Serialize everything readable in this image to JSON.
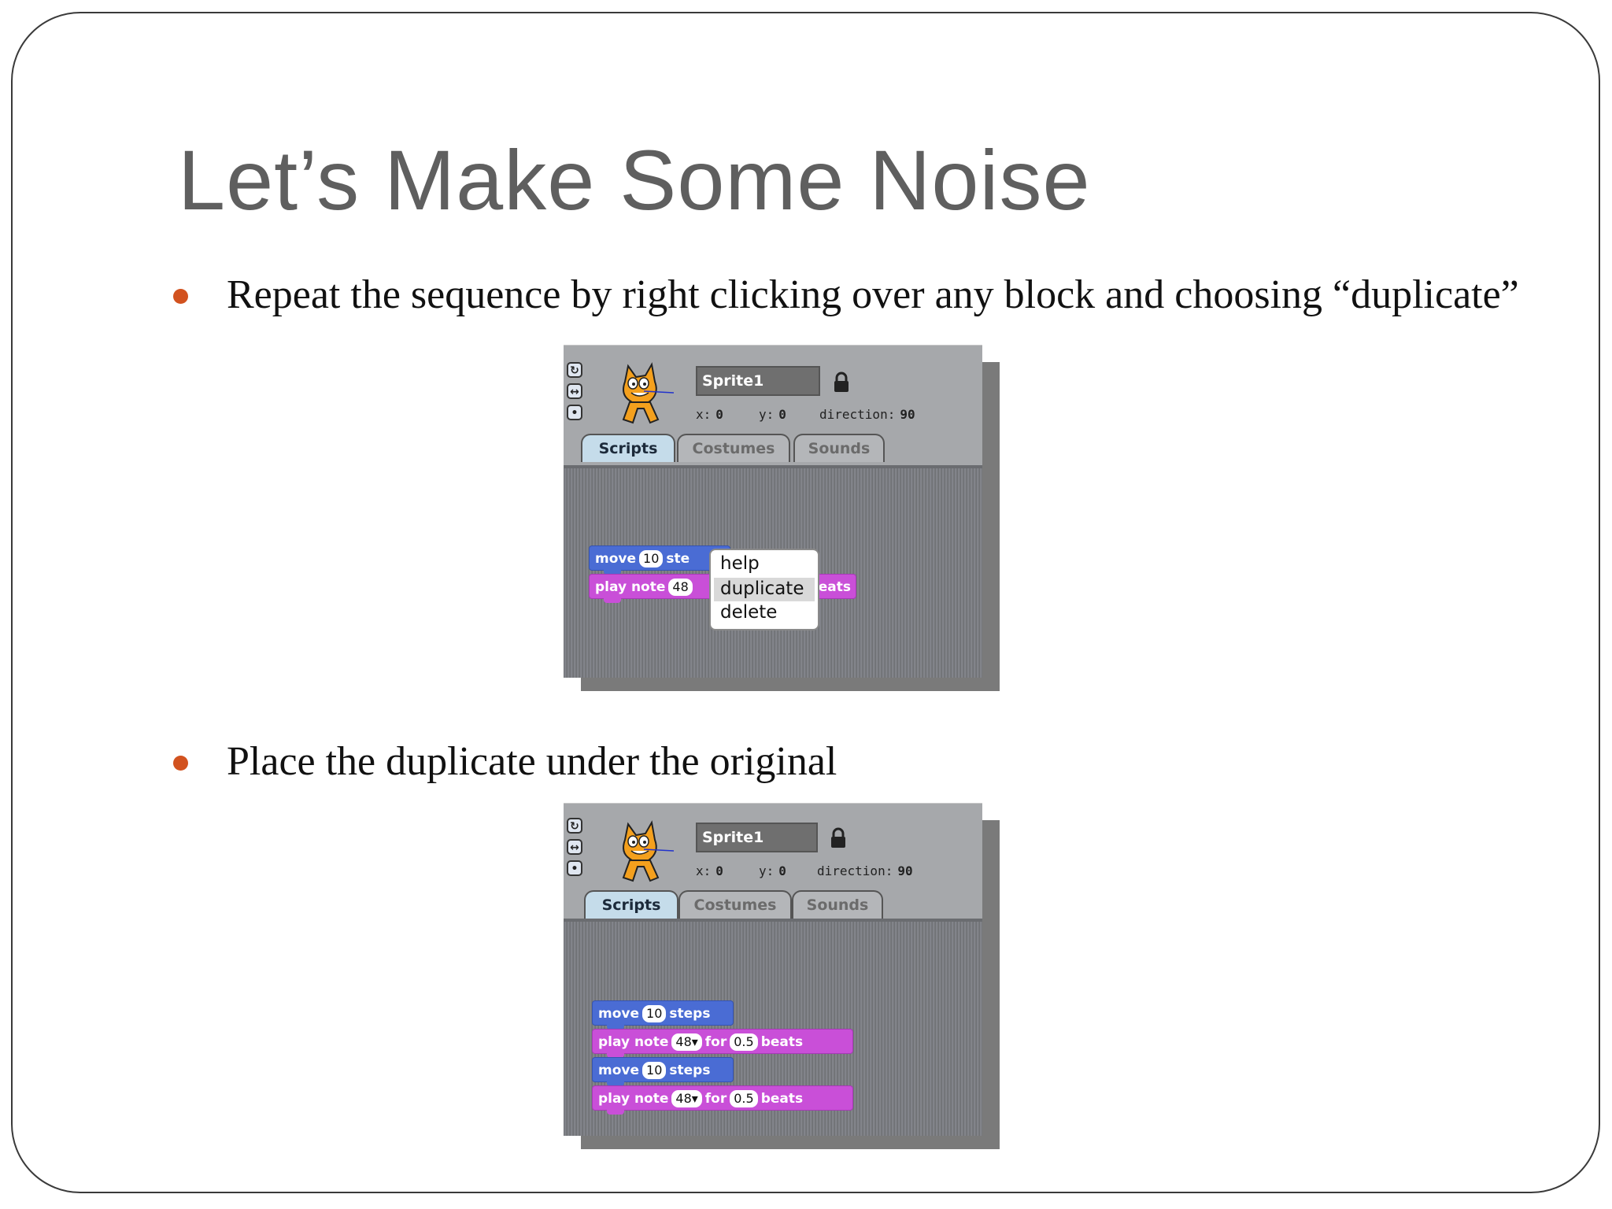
{
  "slide": {
    "title": "Let’s Make Some Noise",
    "bullets": [
      "Repeat the sequence by right clicking over any block  and choosing “duplicate”",
      "Place the duplicate under the original"
    ],
    "accent_color": "#d2521f"
  },
  "panel1": {
    "sprite_name": "Sprite1",
    "x_label": "x:",
    "x_value": "0",
    "y_label": "y:",
    "y_value": "0",
    "direction_label": "direction:",
    "direction_value": "90",
    "tabs": [
      "Scripts",
      "Costumes",
      "Sounds"
    ],
    "block_move": {
      "word": "move",
      "value": "10",
      "suffix": "ste"
    },
    "block_play": {
      "word": "play note",
      "value": "48",
      "suffix": "eats"
    },
    "context_menu": [
      "help",
      "duplicate",
      "delete"
    ]
  },
  "panel2": {
    "sprite_name": "Sprite1",
    "x_label": "x:",
    "x_value": "0",
    "y_label": "y:",
    "y_value": "0",
    "direction_label": "direction:",
    "direction_value": "90",
    "tabs": [
      "Scripts",
      "Costumes",
      "Sounds"
    ],
    "blocks": [
      {
        "word": "move",
        "value": "10",
        "suffix": "steps"
      },
      {
        "word": "play note",
        "value": "48▾",
        "mid": "for",
        "value2": "0.5",
        "suffix": "beats"
      },
      {
        "word": "move",
        "value": "10",
        "suffix": "steps"
      },
      {
        "word": "play note",
        "value": "48▾",
        "mid": "for",
        "value2": "0.5",
        "suffix": "beats"
      }
    ]
  }
}
